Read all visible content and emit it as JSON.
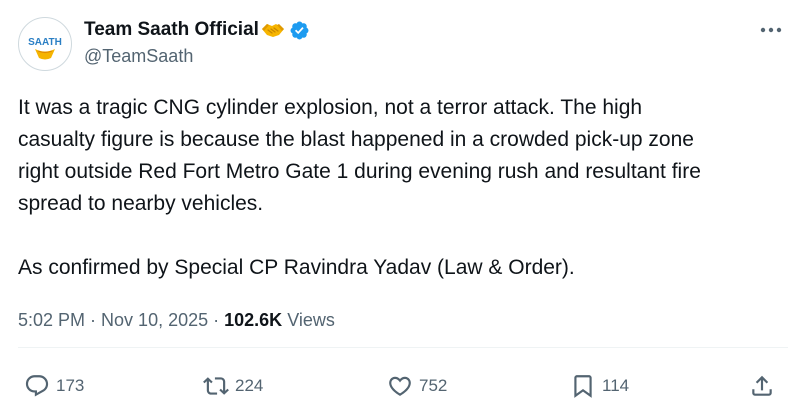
{
  "author": {
    "display_name": "Team Saath Official",
    "handle": "@TeamSaath",
    "avatar_text": "SAATH",
    "name_emoji": "handshake-emoji",
    "verified_icon": "verified-badge-icon"
  },
  "tweet": {
    "lines": [
      "It was a tragic CNG cylinder explosion, not a terror attack. The high",
      "casualty figure is because the blast happened in a crowded pick-up zone",
      "right outside Red Fort Metro Gate 1 during evening rush and resultant fire",
      "spread to nearby vehicles.",
      "",
      "As confirmed by Special CP Ravindra Yadav (Law & Order)."
    ]
  },
  "meta": {
    "time": "5:02 PM",
    "separator": "·",
    "date": "Nov 10, 2025",
    "views_count": "102.6K",
    "views_label": "Views"
  },
  "actions": {
    "replies": "173",
    "reposts": "224",
    "likes": "752",
    "bookmarks": "114"
  },
  "colors": {
    "text": "#0f1419",
    "secondary": "#536471",
    "verified": "#1d9bf0",
    "avatar_ring": "#2b7fc4",
    "avatar_emblem": "#f5b400"
  }
}
